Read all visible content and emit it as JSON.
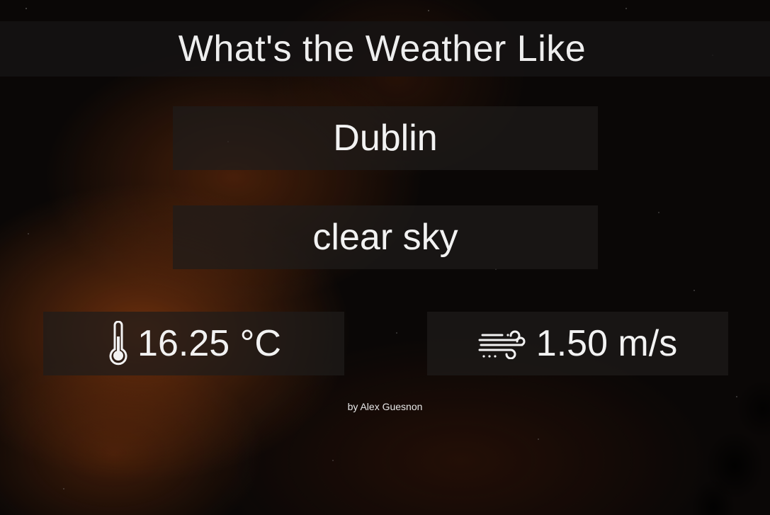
{
  "header": {
    "title": "What's the Weather Like"
  },
  "weather": {
    "city": "Dublin",
    "description": "clear sky",
    "temperature": "16.25 °C",
    "wind": "1.50 m/s"
  },
  "icons": {
    "temperature": "thermometer-icon",
    "wind": "wind-icon"
  },
  "footer": {
    "credit": "by Alex Guesnon"
  },
  "colors": {
    "text": "#f2f2f2",
    "panel": "#1e1c1b"
  }
}
